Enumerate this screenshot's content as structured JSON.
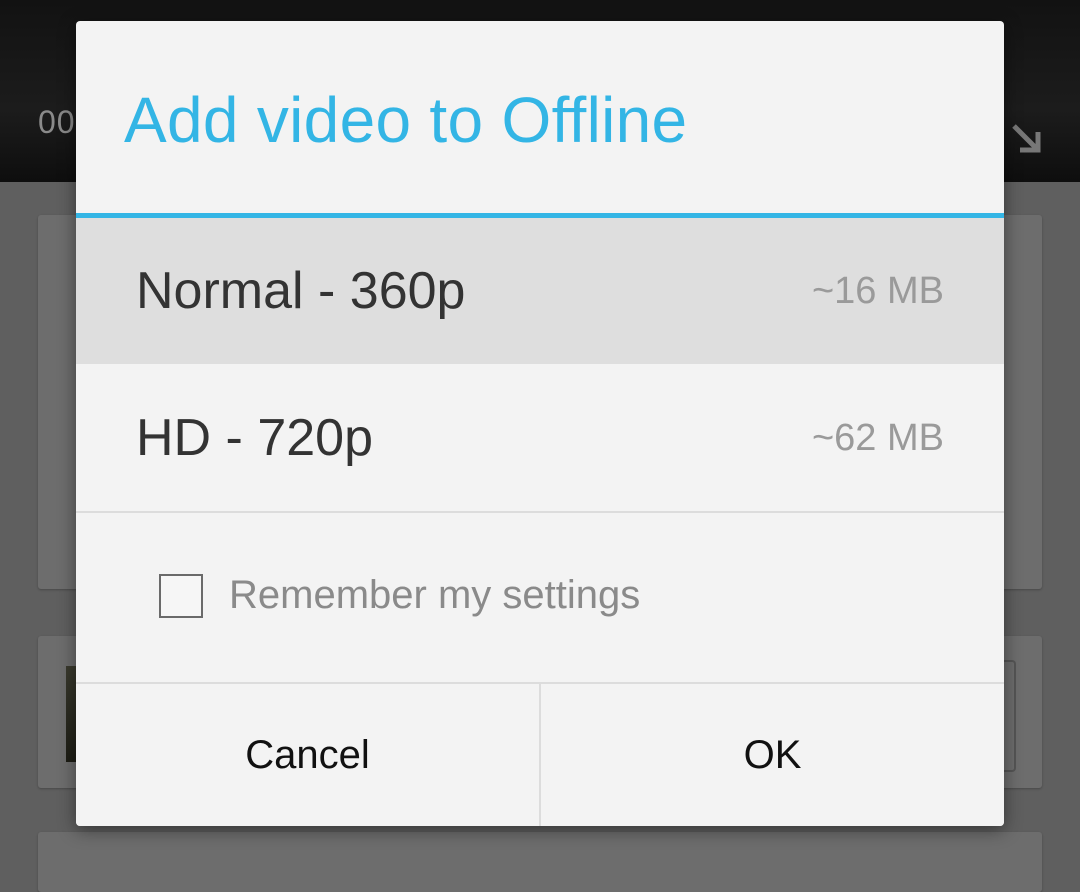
{
  "background": {
    "video_time": "00",
    "fullscreen_icon": "fullscreen-exit-icon"
  },
  "dialog": {
    "title": "Add video to Offline",
    "accent_color": "#33b5e5",
    "options": [
      {
        "label": "Normal - 360p",
        "size": "~16 MB",
        "highlighted": true
      },
      {
        "label": "HD - 720p",
        "size": "~62 MB",
        "highlighted": false
      }
    ],
    "remember": {
      "label": "Remember my settings",
      "checked": false
    },
    "buttons": {
      "cancel": "Cancel",
      "ok": "OK"
    }
  }
}
